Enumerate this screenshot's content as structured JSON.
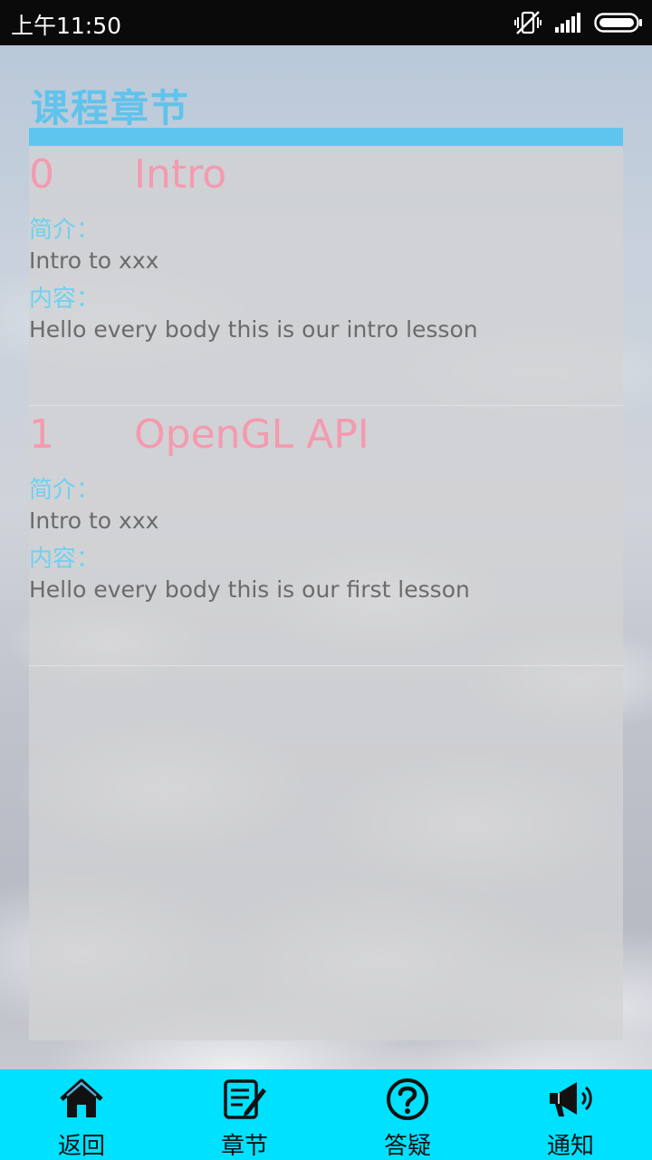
{
  "status_bar": {
    "time": "上午11:50",
    "icons": [
      "vibrate-off-icon",
      "signal-icon",
      "battery-icon"
    ]
  },
  "page": {
    "title": "课程章节"
  },
  "chapters": [
    {
      "number": "0",
      "name": "Intro",
      "intro_label": "简介：",
      "intro_text": "Intro to xxx",
      "content_label": "内容：",
      "content_text": "Hello every body this is our intro lesson"
    },
    {
      "number": "1",
      "name": "OpenGL API",
      "intro_label": "简介：",
      "intro_text": "Intro to xxx",
      "content_label": "内容：",
      "content_text": "Hello every body this is our first lesson"
    }
  ],
  "bottom_nav": {
    "items": [
      {
        "label": "返回",
        "icon": "home-icon"
      },
      {
        "label": "章节",
        "icon": "edit-note-icon"
      },
      {
        "label": "答疑",
        "icon": "question-icon"
      },
      {
        "label": "通知",
        "icon": "megaphone-icon"
      }
    ]
  },
  "colors": {
    "accent": "#5ec6ee",
    "title": "#5fc3ec",
    "chapter_heading": "#f49ab0",
    "label": "#6fd0f0",
    "nav_bg": "#00e0ff"
  }
}
